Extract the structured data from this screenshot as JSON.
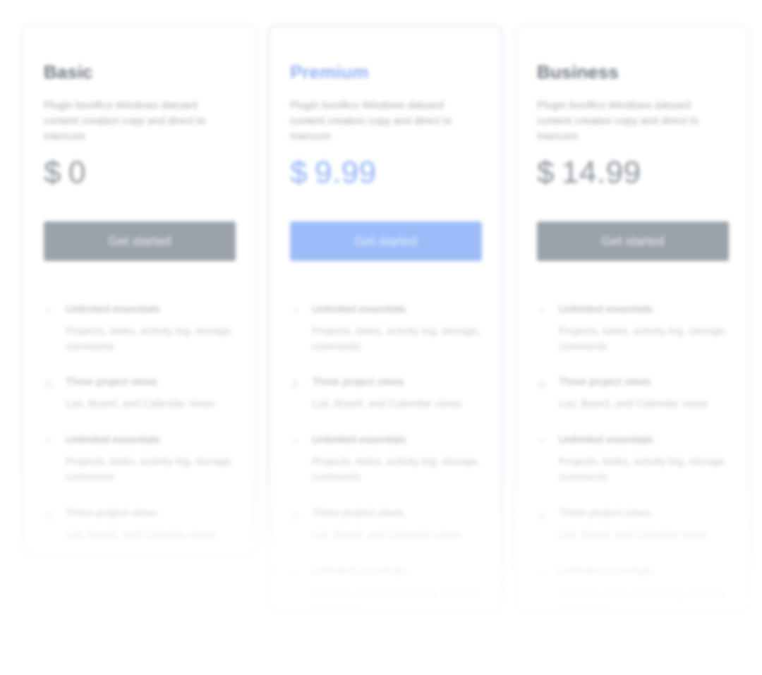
{
  "plans": [
    {
      "name": "Basic",
      "description": "Plugin bonifico Windows datoard content creation copy and direct to Intercom",
      "currency": "$",
      "price": "0",
      "cta_label": "Get started",
      "features": [
        {
          "icon": "circle-icon",
          "title": "Unlimited essentials",
          "description": "Projects, tasks, activity log, storage, comments"
        },
        {
          "icon": "triangle-icon",
          "title": "Three project views",
          "description": "List, Board, and Calendar views"
        },
        {
          "icon": "circle-icon",
          "title": "Unlimited essentials",
          "description": "Projects, tasks, activity log, storage, comments"
        },
        {
          "icon": "triangle-icon",
          "title": "Three project views",
          "description": "List, Board, and Calendar views"
        }
      ]
    },
    {
      "name": "Premium",
      "description": "Plugin bonifico Windows datoard content creation copy and direct to Intercom",
      "currency": "$",
      "price": "9.99",
      "cta_label": "Get started",
      "features": [
        {
          "icon": "circle-icon",
          "title": "Unlimited essentials",
          "description": "Projects, tasks, activity log, storage, comments"
        },
        {
          "icon": "triangle-icon",
          "title": "Three project views",
          "description": "List, Board, and Calendar views"
        },
        {
          "icon": "circle-icon",
          "title": "Unlimited essentials",
          "description": "Projects, tasks, activity log, storage, comments"
        },
        {
          "icon": "triangle-icon",
          "title": "Three project views",
          "description": "List, Board, and Calendar views"
        },
        {
          "icon": "circle-icon",
          "title": "Unlimited essentials",
          "description": "Projects, tasks, activity log, storage, comments"
        }
      ]
    },
    {
      "name": "Business",
      "description": "Plugin bonifico Windows datoard content creation copy and direct to Intercom",
      "currency": "$",
      "price": "14.99",
      "cta_label": "Get started",
      "features": [
        {
          "icon": "circle-icon",
          "title": "Unlimited essentials",
          "description": "Projects, tasks, activity log, storage, comments"
        },
        {
          "icon": "triangle-icon",
          "title": "Three project views",
          "description": "List, Board, and Calendar views"
        },
        {
          "icon": "circle-icon",
          "title": "Unlimited essentials",
          "description": "Projects, tasks, activity log, storage, comments"
        },
        {
          "icon": "triangle-icon",
          "title": "Three project views",
          "description": "List, Board, and Calendar views"
        },
        {
          "icon": "circle-icon",
          "title": "Unlimited essentials",
          "description": "Projects, tasks, activity log, storage, comments"
        }
      ]
    }
  ],
  "colors": {
    "accent": "#8fb2f6",
    "neutral_button": "#9aa2aa",
    "accent_button": "#9bbcf8"
  }
}
